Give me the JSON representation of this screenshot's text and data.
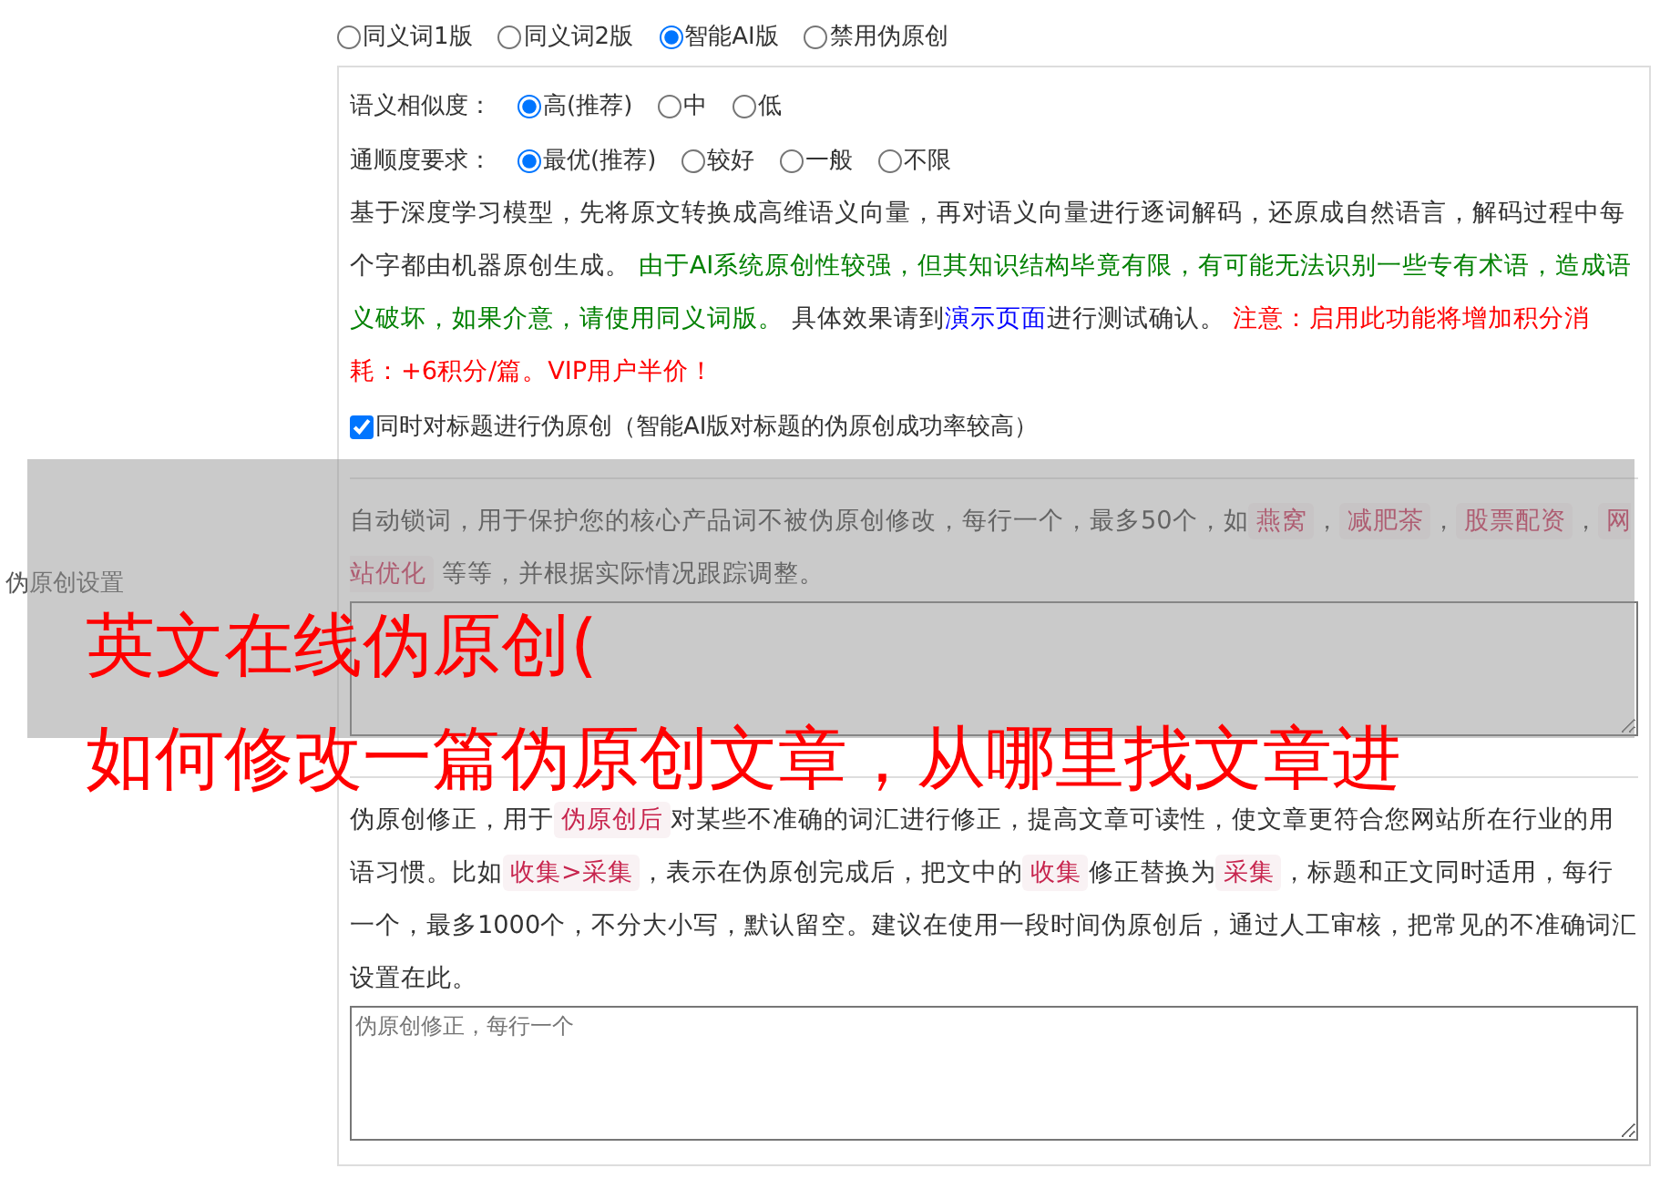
{
  "settings_label": "伪原创设置",
  "mode_options": [
    {
      "label": "同义词1版",
      "selected": false
    },
    {
      "label": "同义词2版",
      "selected": false
    },
    {
      "label": "智能AI版",
      "selected": true
    },
    {
      "label": "禁用伪原创",
      "selected": false
    }
  ],
  "similarity": {
    "label": "语义相似度：",
    "options": [
      {
        "label": "高(推荐)",
        "selected": true
      },
      {
        "label": "中",
        "selected": false
      },
      {
        "label": "低",
        "selected": false
      }
    ]
  },
  "fluency": {
    "label": "通顺度要求：",
    "options": [
      {
        "label": "最优(推荐)",
        "selected": true
      },
      {
        "label": "较好",
        "selected": false
      },
      {
        "label": "一般",
        "selected": false
      },
      {
        "label": "不限",
        "selected": false
      }
    ]
  },
  "ai_description": [
    {
      "kind": "plain",
      "text": "基于深度学习模型，先将原文转换成高维语义向量，再对语义向量进行逐词解码，还原成自然语言，解码过程中每个字都由机器原创生成。 "
    },
    {
      "kind": "green",
      "text": "由于AI系统原创性较强，但其知识结构毕竟有限，有可能无法识别一些专有术语，造成语义破坏，如果介意，请使用同义词版。"
    },
    {
      "kind": "plain",
      "text": " 具体效果请到"
    },
    {
      "kind": "link",
      "text": "演示页面"
    },
    {
      "kind": "plain",
      "text": "进行测试确认。 "
    },
    {
      "kind": "red",
      "text": "注意：启用此功能将增加积分消耗：+6积分/篇。VIP用户半价！"
    }
  ],
  "title_checkbox": {
    "label": "同时对标题进行伪原创（智能AI版对标题的伪原创成功率较高）",
    "checked": true
  },
  "lock_words": {
    "description": [
      {
        "kind": "plain",
        "text": "自动锁词，用于保护您的核心产品词不被伪原创修改，每行一个，最多50个，如"
      },
      {
        "kind": "tag",
        "text": "燕窝"
      },
      {
        "kind": "plain",
        "text": "，"
      },
      {
        "kind": "tag",
        "text": "减肥茶"
      },
      {
        "kind": "plain",
        "text": "，"
      },
      {
        "kind": "tag",
        "text": "股票配资"
      },
      {
        "kind": "plain",
        "text": "，"
      },
      {
        "kind": "tag",
        "text": "网站优化"
      },
      {
        "kind": "plain",
        "text": " 等等，并根据实际情况跟踪调整。"
      }
    ]
  },
  "corrections": {
    "description": [
      {
        "kind": "plain",
        "text": "伪原创修正，用于"
      },
      {
        "kind": "tag",
        "text": "伪原创后"
      },
      {
        "kind": "plain",
        "text": "对某些不准确的词汇进行修正，提高文章可读性，使文章更符合您网站所在行业的用语习惯。比如"
      },
      {
        "kind": "tag",
        "text": "收集>采集"
      },
      {
        "kind": "plain",
        "text": "，表示在伪原创完成后，把文中的"
      },
      {
        "kind": "tag",
        "text": "收集"
      },
      {
        "kind": "plain",
        "text": "修正替换为"
      },
      {
        "kind": "tag",
        "text": "采集"
      },
      {
        "kind": "plain",
        "text": "，标题和正文同时适用，每行一个，最多1000个，不分大小写，默认留空。建议在使用一段时间伪原创后，通过人工审核，把常见的不准确词汇设置在此。"
      }
    ],
    "placeholder": "伪原创修正，每行一个"
  },
  "overlay_title": [
    "英文在线伪原创(",
    "如何修改一篇伪原创文章，从哪里找文章进"
  ]
}
